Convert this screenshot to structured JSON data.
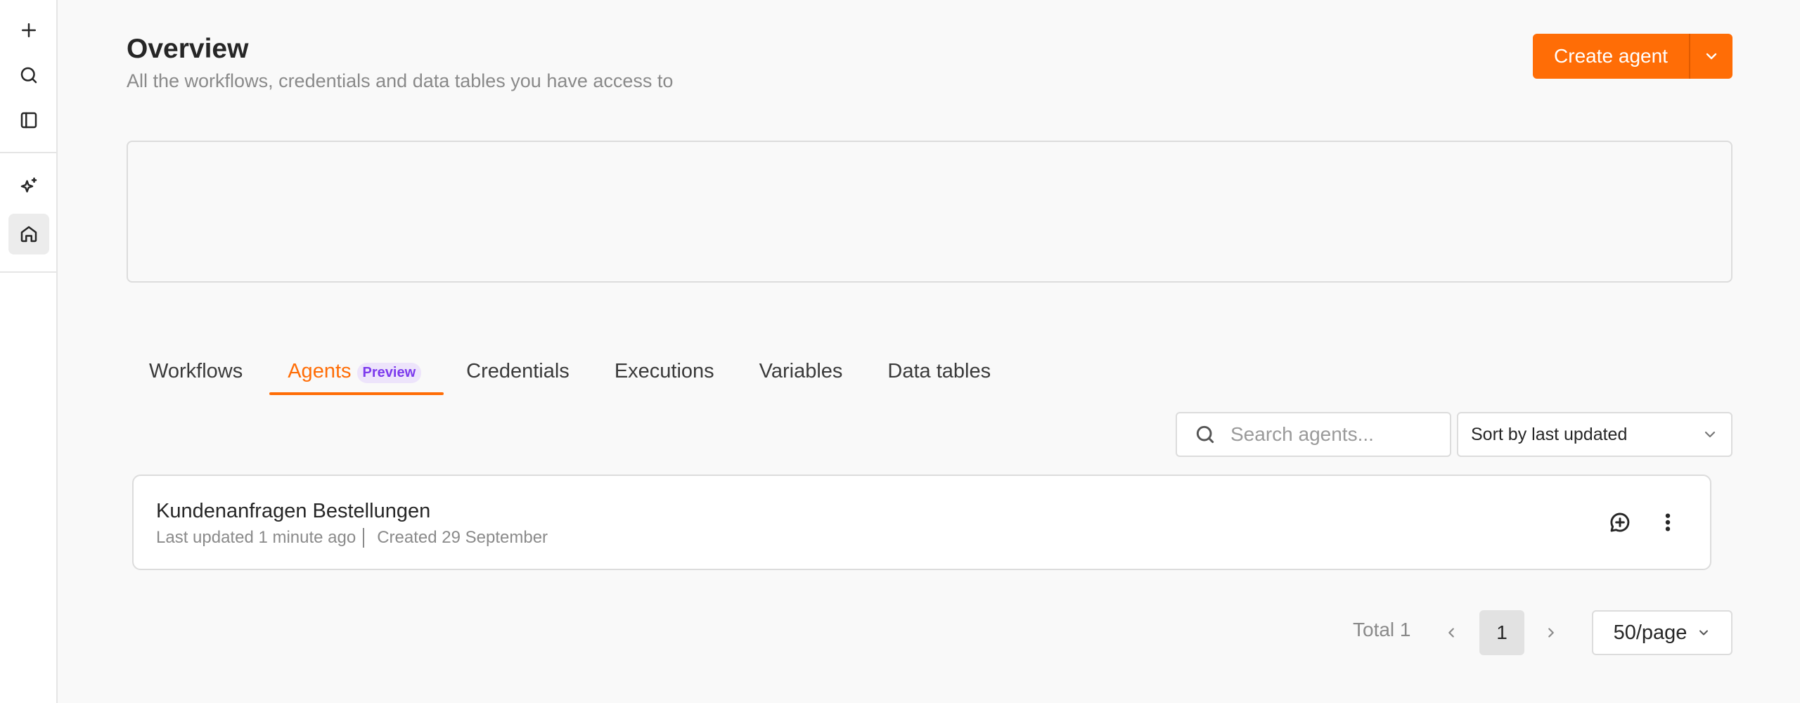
{
  "sidebar": {
    "items": [
      {
        "icon": "plus-icon"
      },
      {
        "icon": "search-icon"
      },
      {
        "icon": "panel-toggle-icon"
      },
      {
        "icon": "sparkles-icon"
      },
      {
        "icon": "home-icon",
        "active": true
      }
    ]
  },
  "header": {
    "title": "Overview",
    "subtitle": "All the workflows, credentials and data tables you have access to",
    "create_label": "Create agent"
  },
  "tabs": [
    {
      "label": "Workflows"
    },
    {
      "label": "Agents",
      "badge": "Preview",
      "active": true
    },
    {
      "label": "Credentials"
    },
    {
      "label": "Executions"
    },
    {
      "label": "Variables"
    },
    {
      "label": "Data tables"
    }
  ],
  "toolbar": {
    "search_placeholder": "Search agents...",
    "sort_value": "Sort by last updated"
  },
  "agents": [
    {
      "name": "Kundenanfragen Bestellungen",
      "last_updated": "Last updated 1 minute ago",
      "created": "Created 29 September"
    }
  ],
  "pagination": {
    "total": "Total 1",
    "current_page": "1",
    "page_size": "50/page"
  },
  "colors": {
    "accent": "#ff6d06",
    "badge_text": "#7c3aed",
    "badge_bg": "#ede4fb"
  }
}
